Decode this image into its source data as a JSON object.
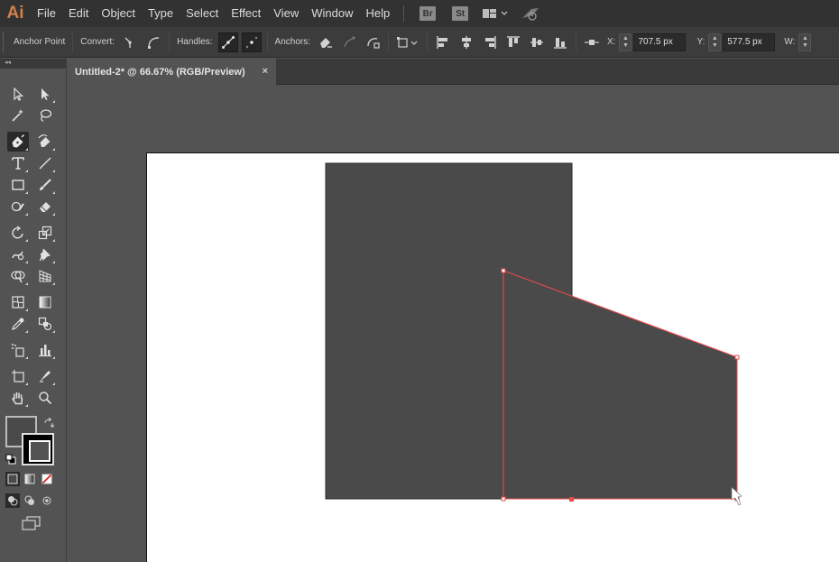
{
  "app": {
    "logo": "Ai",
    "menus": [
      "File",
      "Edit",
      "Object",
      "Type",
      "Select",
      "Effect",
      "View",
      "Window",
      "Help"
    ],
    "bridge_badge": "Br",
    "stock_badge": "St",
    "workspace_icon": "workspace-layout-icon",
    "gpu_icon": "gpu-performance-icon"
  },
  "control_bar": {
    "tool_name": "Anchor Point",
    "convert_label": "Convert:",
    "handles_label": "Handles:",
    "anchors_label": "Anchors:",
    "x_label": "X:",
    "x_value": "707.5 px",
    "y_label": "Y:",
    "y_value": "577.5 px",
    "w_label": "W:"
  },
  "document": {
    "tab_title": "Untitled-2* @ 66.67% (RGB/Preview)",
    "close_glyph": "×"
  },
  "tools": {
    "panel_collapse": "◂◂",
    "active_tool": "pen-tool",
    "fill_color": "#4a4a4a",
    "stroke_color": "#000000"
  },
  "artwork": {
    "shape_fill": "#4a4a4a",
    "selection_color": "#e84a4a",
    "artboard_color": "#ffffff"
  }
}
